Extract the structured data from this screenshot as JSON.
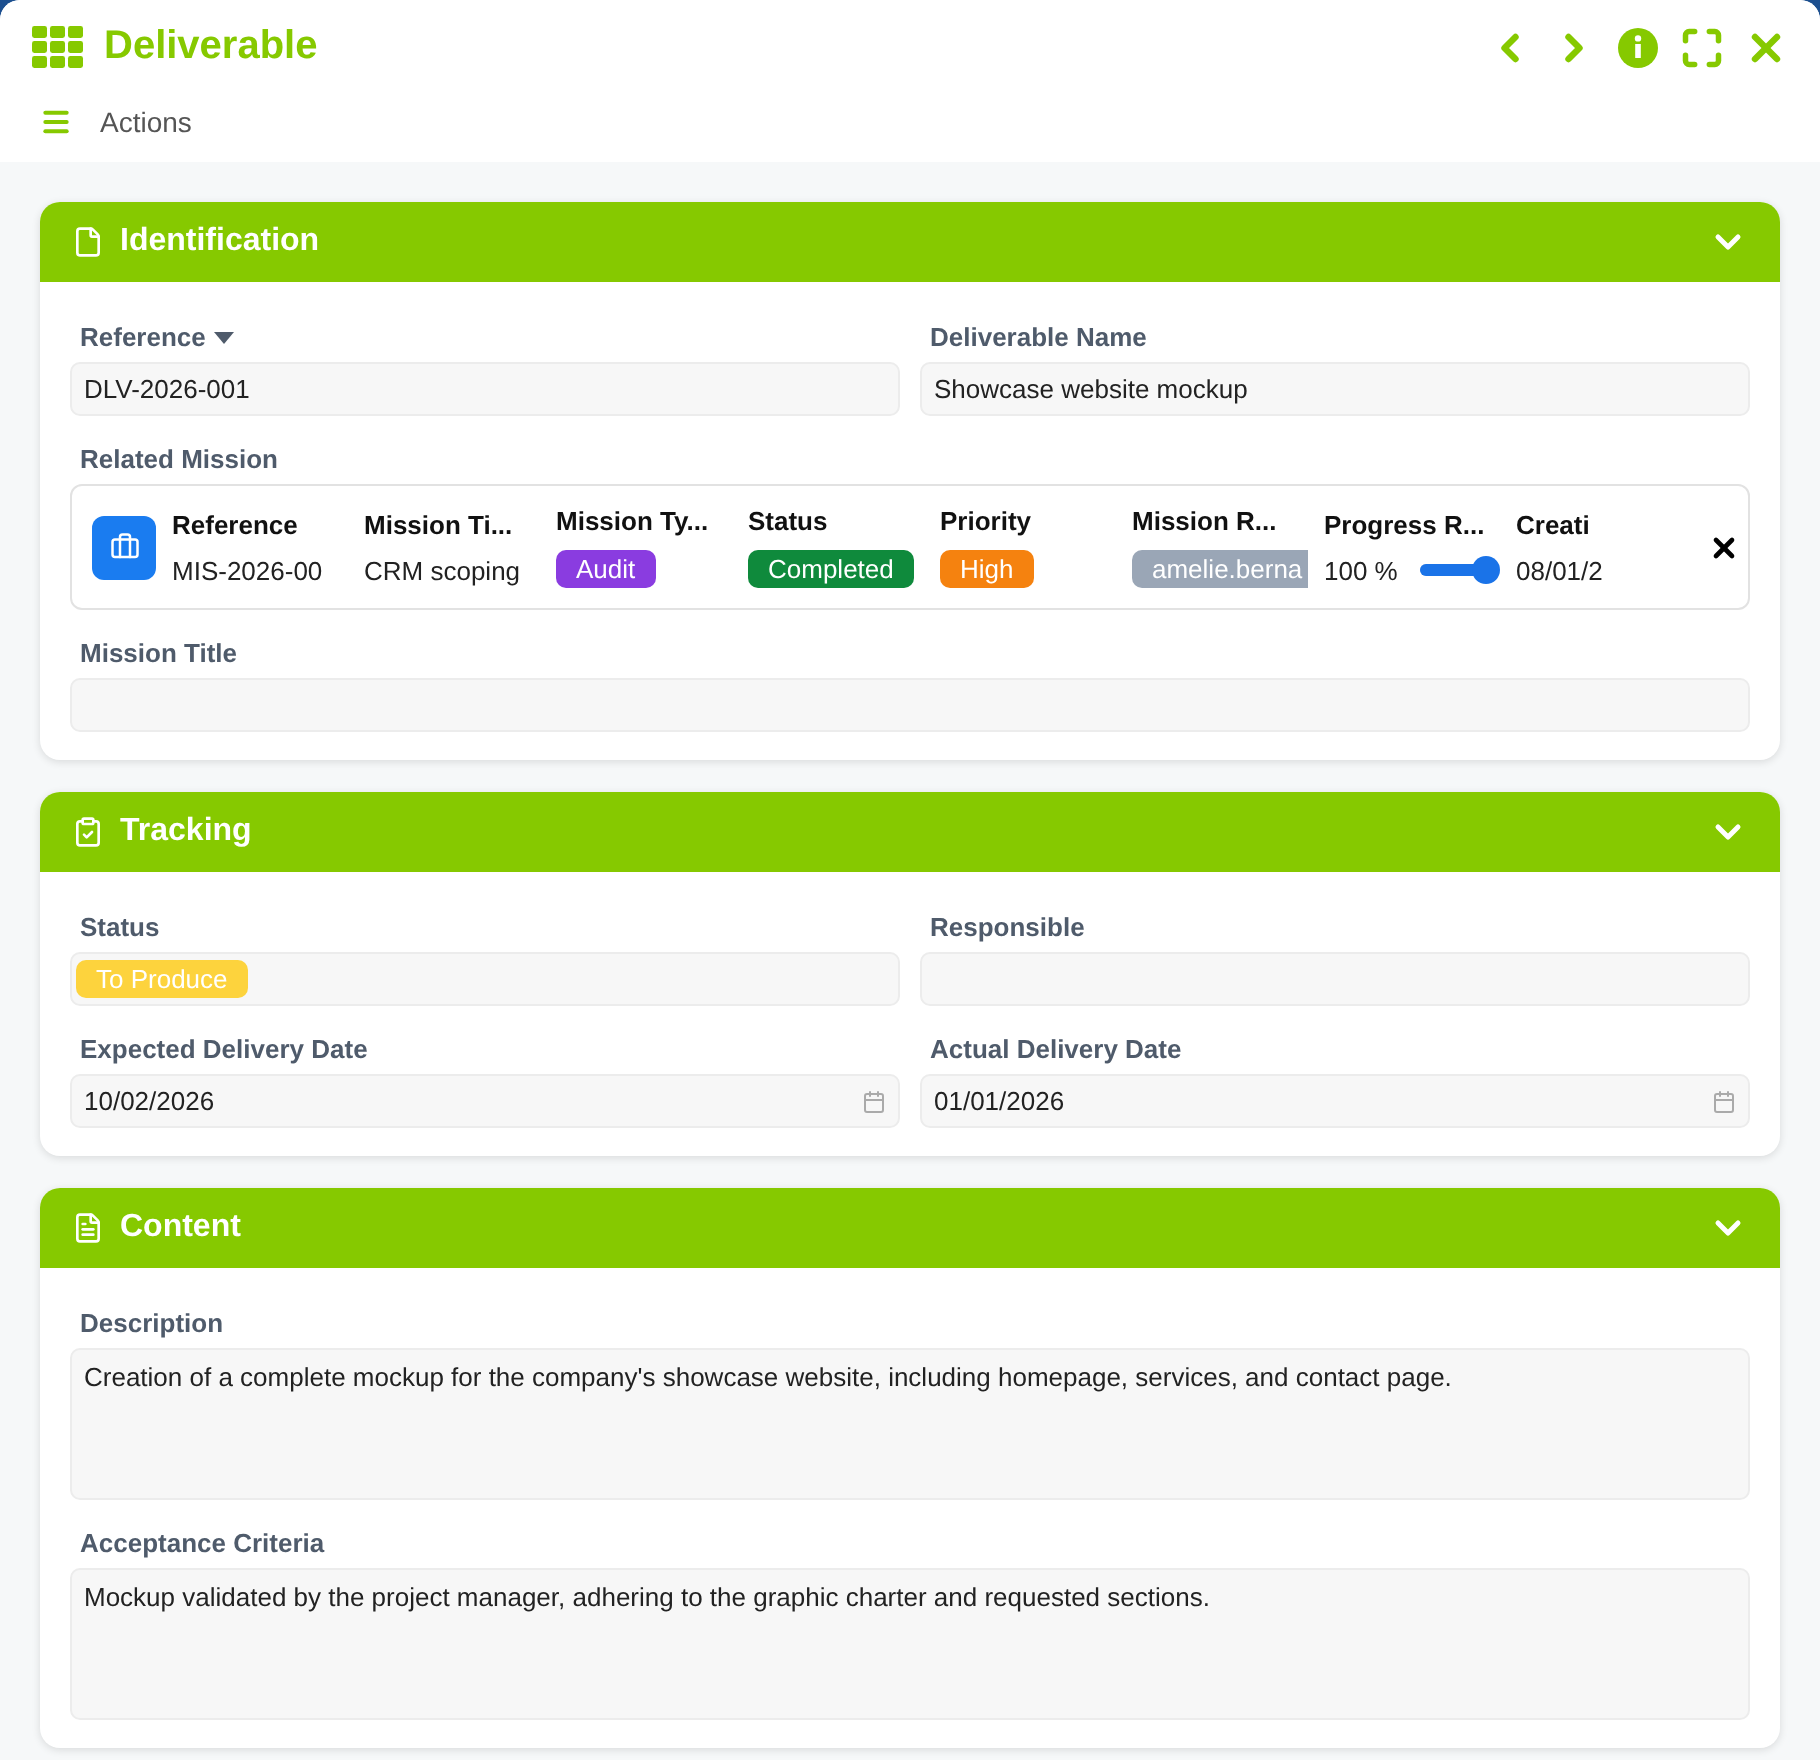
{
  "window": {
    "title": "Deliverable"
  },
  "toolbar": {
    "label": "Actions"
  },
  "sections": [
    {
      "title": "Identification",
      "expanded": true,
      "fields": [
        {
          "kind": "select",
          "label": "Reference",
          "value": "DLV-2026-001"
        },
        {
          "kind": "text",
          "label": "Deliverable Name",
          "value": "Showcase website mockup"
        },
        {
          "kind": "relation",
          "label": "Related Mission",
          "columns": [
            {
              "header": "Reference",
              "kind": "text",
              "value": "MIS-2026-00"
            },
            {
              "header": "Mission Ti...",
              "kind": "text",
              "value": "CRM scoping"
            },
            {
              "header": "Mission Ty...",
              "kind": "badge",
              "value": "Audit",
              "color": "#8a3ce0"
            },
            {
              "header": "Status",
              "kind": "badge",
              "value": "Completed",
              "color": "#0f8a3c"
            },
            {
              "header": "Priority",
              "kind": "badge",
              "value": "High",
              "color": "#f5820f"
            },
            {
              "header": "Mission R...",
              "kind": "badge",
              "value": "amelie.berna",
              "color": "#9aa6b6"
            },
            {
              "header": "Progress R...",
              "kind": "progress",
              "value": "100 %",
              "level": 1
            },
            {
              "header": "Creati",
              "kind": "text",
              "value": "08/01/2"
            }
          ]
        },
        {
          "kind": "wide-text",
          "label": "Mission Title"
        }
      ]
    },
    {
      "title": "Tracking",
      "expanded": true,
      "fields": [
        {
          "kind": "badge",
          "label": "Status",
          "value": "To Produce",
          "color": "#fdd33d"
        },
        {
          "kind": "text",
          "label": "Responsible"
        },
        {
          "kind": "date",
          "label": "Expected Delivery Date",
          "value": "10/02/2026"
        },
        {
          "kind": "date",
          "label": "Actual Delivery Date",
          "value": "01/01/2026"
        }
      ]
    },
    {
      "title": "Content",
      "expanded": true,
      "fields": [
        {
          "kind": "textarea",
          "label": "Description",
          "value": "Creation of a complete mockup for the company's showcase website, including homepage, services, and contact page."
        },
        {
          "kind": "textarea",
          "label": "Acceptance Criteria",
          "value": "Mockup validated by the project manager, adhering to the graphic charter and requested sections."
        }
      ]
    }
  ]
}
